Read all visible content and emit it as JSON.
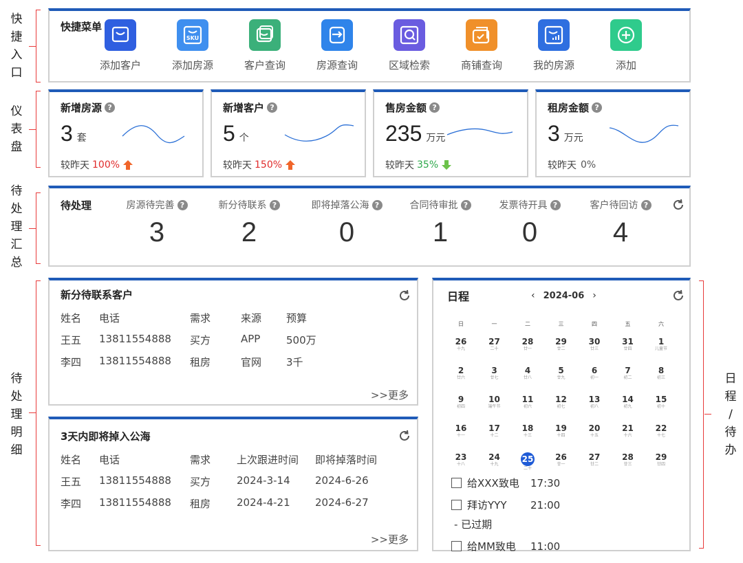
{
  "side_labels": {
    "quick": [
      "快",
      "捷",
      "入",
      "口"
    ],
    "dashboard": [
      "仪",
      "表",
      "盘"
    ],
    "pending_summary": [
      "待",
      "处",
      "理",
      "汇",
      "总"
    ],
    "pending_detail": [
      "待",
      "处",
      "理",
      "明",
      "细"
    ],
    "schedule": [
      "日",
      "程",
      "/",
      "待",
      "办"
    ]
  },
  "quick_menu": {
    "title": "快捷菜单",
    "items": [
      {
        "label": "添加客户",
        "icon": "add-customer-icon",
        "color": "#2f5fe0"
      },
      {
        "label": "添加房源",
        "icon": "sku-icon",
        "color": "#3f8fef"
      },
      {
        "label": "客户查询",
        "icon": "customer-query-icon",
        "color": "#3bb07a"
      },
      {
        "label": "房源查询",
        "icon": "house-query-icon",
        "color": "#2f84ea"
      },
      {
        "label": "区域检索",
        "icon": "region-search-icon",
        "color": "#6a5ce0"
      },
      {
        "label": "商铺查询",
        "icon": "shop-query-icon",
        "color": "#f0902a"
      },
      {
        "label": "我的房源",
        "icon": "my-house-icon",
        "color": "#2f6fe0"
      },
      {
        "label": "添加",
        "icon": "plus-icon",
        "color": "#2fcb8c"
      }
    ]
  },
  "dashboard": {
    "cards": [
      {
        "title": "新增房源",
        "value": "3",
        "unit": "套",
        "compare_label": "较昨天",
        "pct": "100%",
        "trend": "up"
      },
      {
        "title": "新增客户",
        "value": "5",
        "unit": "个",
        "compare_label": "较昨天",
        "pct": "150%",
        "trend": "up"
      },
      {
        "title": "售房金额",
        "value": "235",
        "unit": "万元",
        "compare_label": "较昨天",
        "pct": "35%",
        "trend": "down"
      },
      {
        "title": "租房金额",
        "value": "3",
        "unit": "万元",
        "compare_label": "较昨天",
        "pct": "0%",
        "trend": "flat"
      }
    ]
  },
  "pending": {
    "title": "待处理",
    "items": [
      {
        "label": "房源待完善",
        "count": "3"
      },
      {
        "label": "新分待联系",
        "count": "2"
      },
      {
        "label": "即将掉落公海",
        "count": "0"
      },
      {
        "label": "合同待审批",
        "count": "1"
      },
      {
        "label": "发票待开具",
        "count": "0"
      },
      {
        "label": "客户待回访",
        "count": "4"
      }
    ]
  },
  "new_contacts": {
    "title": "新分待联系客户",
    "headers": [
      "姓名",
      "电话",
      "需求",
      "来源",
      "预算"
    ],
    "rows": [
      [
        "王五",
        "13811554888",
        "买方",
        "APP",
        "500万"
      ],
      [
        "李四",
        "13811554888",
        "租房",
        "官网",
        "3千"
      ]
    ],
    "more": ">>更多"
  },
  "public_pool": {
    "title": "3天内即将掉入公海",
    "headers": [
      "姓名",
      "电话",
      "需求",
      "上次跟进时间",
      "即将掉落时间"
    ],
    "rows": [
      [
        "王五",
        "13811554888",
        "买方",
        "2024-3-14",
        "2024-6-26"
      ],
      [
        "李四",
        "13811554888",
        "租房",
        "2024-4-21",
        "2024-6-27"
      ]
    ],
    "more": ">>更多"
  },
  "calendar": {
    "title": "日程",
    "month": "2024-06",
    "prev": "‹",
    "next": "›",
    "weekdays": [
      "日",
      "一",
      "二",
      "三",
      "四",
      "五",
      "六"
    ],
    "weeks": [
      [
        [
          "26",
          "十九"
        ],
        [
          "27",
          "二十"
        ],
        [
          "28",
          "廿一"
        ],
        [
          "29",
          "廿二"
        ],
        [
          "30",
          "廿三"
        ],
        [
          "31",
          "廿四"
        ],
        [
          "1",
          "儿童节"
        ]
      ],
      [
        [
          "2",
          "廿六"
        ],
        [
          "3",
          "廿七"
        ],
        [
          "4",
          "廿八"
        ],
        [
          "5",
          "廿九"
        ],
        [
          "6",
          "初一"
        ],
        [
          "7",
          "初二"
        ],
        [
          "8",
          "初三"
        ]
      ],
      [
        [
          "9",
          "初四"
        ],
        [
          "10",
          "端午节"
        ],
        [
          "11",
          "初六"
        ],
        [
          "12",
          "初七"
        ],
        [
          "13",
          "初八"
        ],
        [
          "14",
          "初九"
        ],
        [
          "15",
          "初十"
        ]
      ],
      [
        [
          "16",
          "十一"
        ],
        [
          "17",
          "十二"
        ],
        [
          "18",
          "十三"
        ],
        [
          "19",
          "十四"
        ],
        [
          "20",
          "十五"
        ],
        [
          "21",
          "十六"
        ],
        [
          "22",
          "十七"
        ]
      ],
      [
        [
          "23",
          "十八"
        ],
        [
          "24",
          "十九"
        ],
        [
          "25",
          "二十"
        ],
        [
          "26",
          "廿一"
        ],
        [
          "27",
          "廿二"
        ],
        [
          "28",
          "廿三"
        ],
        [
          "29",
          "廿四"
        ]
      ]
    ],
    "today": "25",
    "todos": [
      {
        "text": "给XXX致电",
        "time": "17:30"
      },
      {
        "text": "拜访YYY",
        "time": "21:00"
      },
      {
        "text": "给MM致电",
        "time": "11:00"
      }
    ],
    "overdue_note": "- 已过期"
  }
}
